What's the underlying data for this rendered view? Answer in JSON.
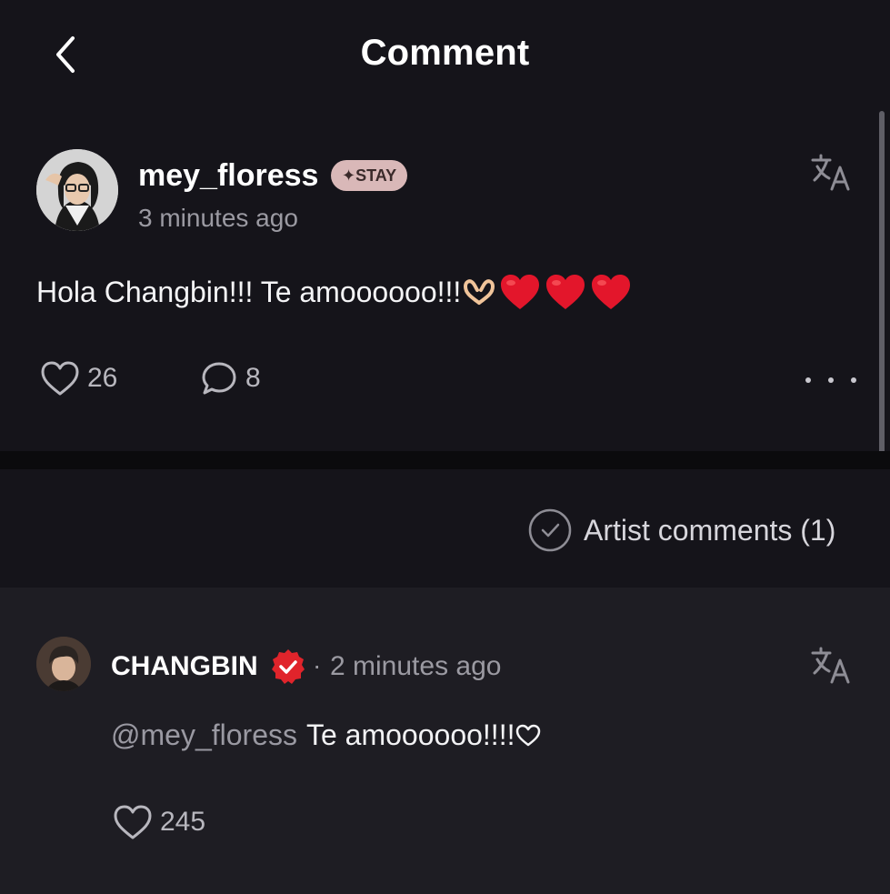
{
  "header": {
    "title": "Comment"
  },
  "post": {
    "username": "mey_floress",
    "badge": "✦STAY",
    "timestamp": "3 minutes ago",
    "text": "Hola Changbin!!! Te amoooooo!!!",
    "likes": "26",
    "replies": "8"
  },
  "filter": {
    "label": "Artist comments (1)"
  },
  "reply": {
    "artist": "CHANGBIN",
    "separator": "·",
    "timestamp": "2 minutes ago",
    "mention": "@mey_floress",
    "text": "Te amoooooo!!!!",
    "likes": "245"
  },
  "colors": {
    "background": "#15141a",
    "reply_background": "#1e1d23",
    "badge": "#d9b8b8",
    "verified": "#e0242b",
    "heart_emoji": "#e3162b"
  },
  "icons": [
    "back-icon",
    "translate-icon",
    "heart-icon",
    "comment-icon",
    "more-icon",
    "check-circle-icon",
    "verified-icon",
    "heart-hands-emoji",
    "red-heart-emoji"
  ]
}
